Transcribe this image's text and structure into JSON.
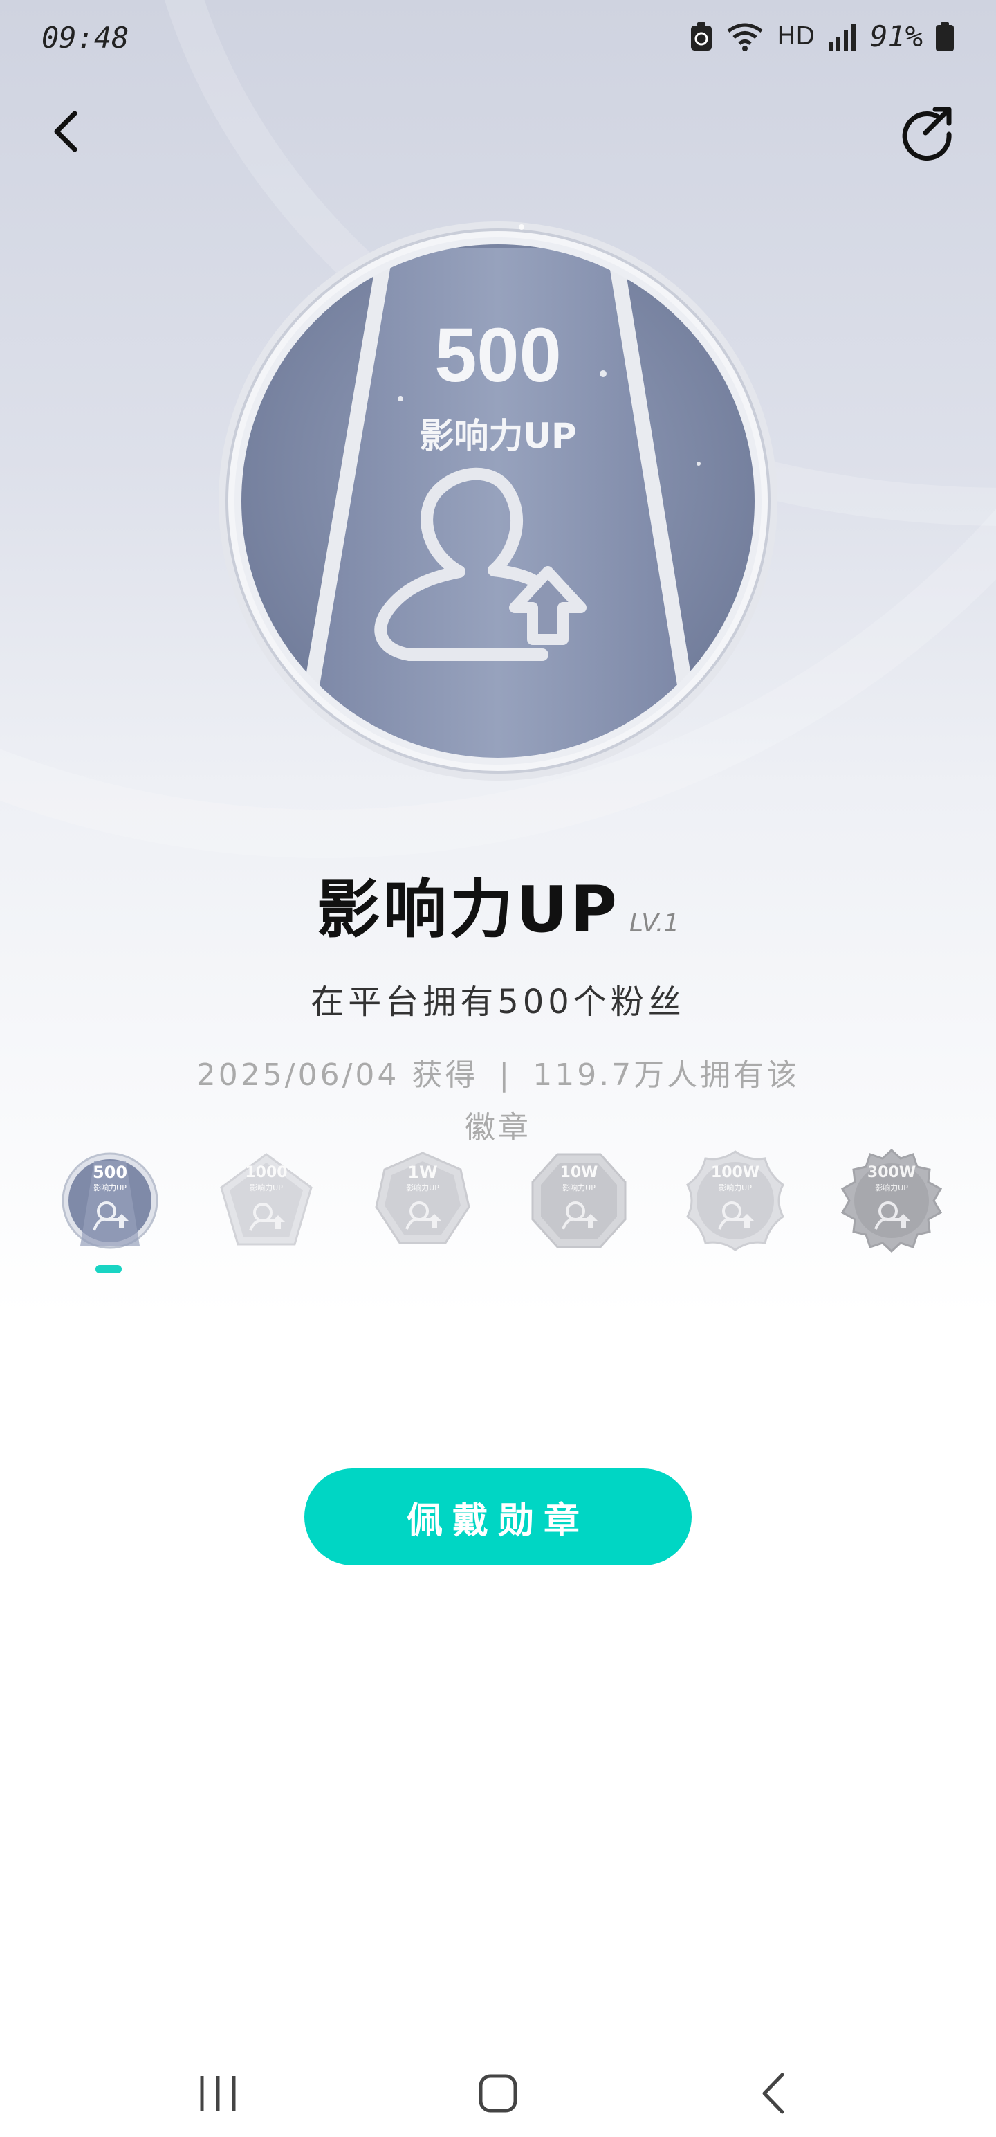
{
  "status_bar": {
    "time": "09:48",
    "network": "HD",
    "battery": "91%"
  },
  "badge": {
    "number": "500",
    "label": "影响力UP",
    "title": "影响力UP",
    "level": "LV.1",
    "description": "在平台拥有500个粉丝",
    "obtained_date": "2025/06/04 获得",
    "owners": "119.7万人拥有该徽章",
    "separator": "|"
  },
  "levels": [
    {
      "number": "500",
      "label": "影响力UP",
      "active": true
    },
    {
      "number": "1000",
      "label": "影响力UP",
      "active": false
    },
    {
      "number": "1W",
      "label": "影响力UP",
      "active": false
    },
    {
      "number": "10W",
      "label": "影响力UP",
      "active": false
    },
    {
      "number": "100W",
      "label": "影响力UP",
      "active": false
    },
    {
      "number": "300W",
      "label": "影响力UP",
      "active": false
    }
  ],
  "actions": {
    "wear_label": "佩戴勋章"
  },
  "colors": {
    "accent": "#00d6c4",
    "badge_blue": "#7f8aa8",
    "badge_silver": "#d8dbe3"
  }
}
